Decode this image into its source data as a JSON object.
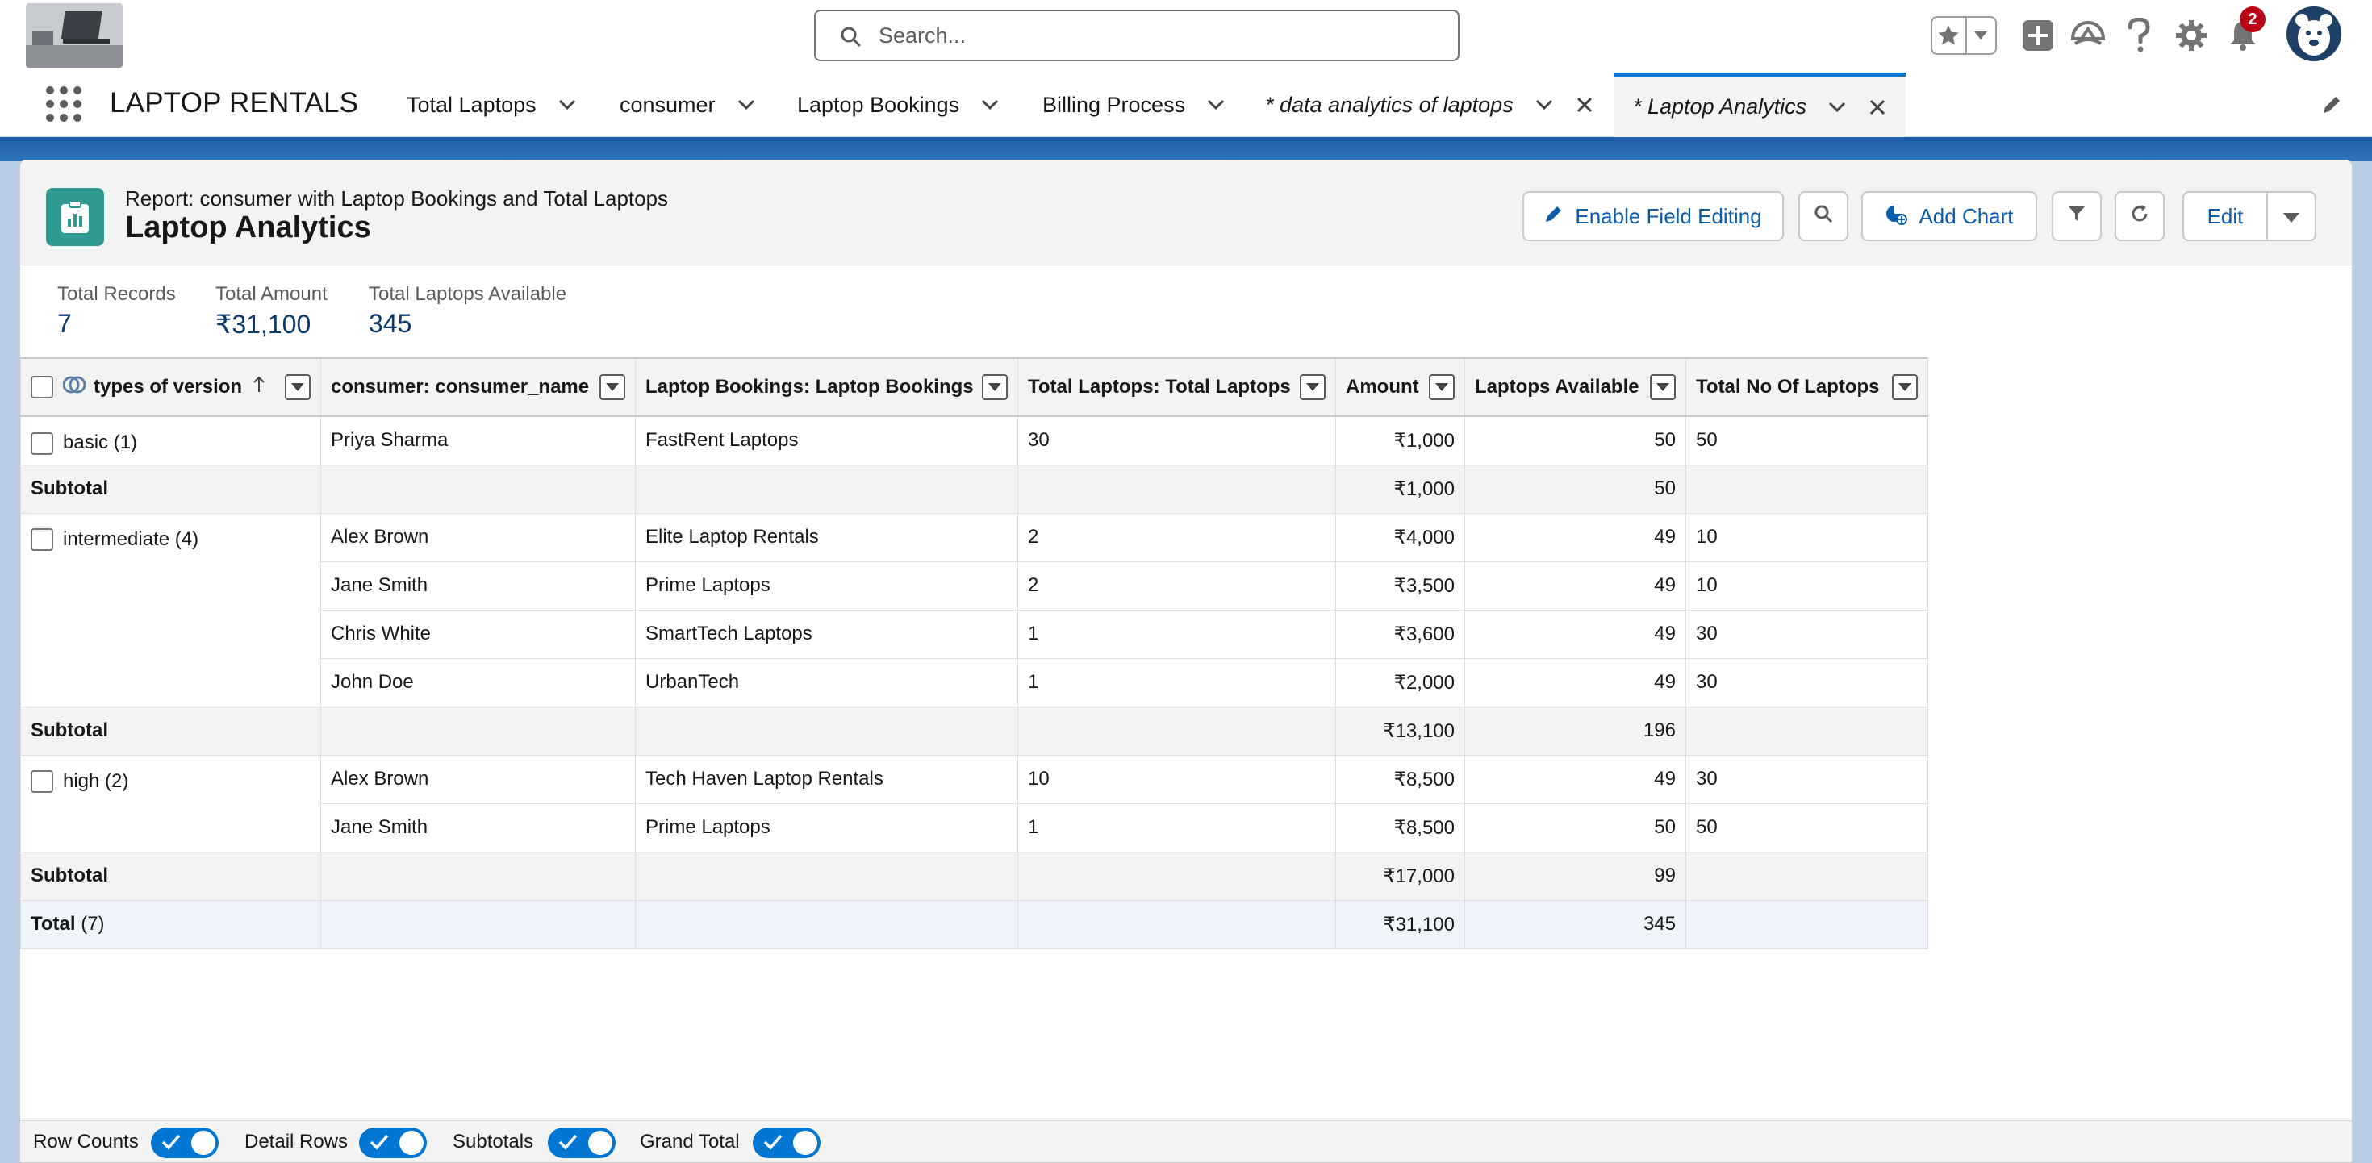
{
  "header": {
    "search_placeholder": "Search...",
    "notifications_count": "2"
  },
  "nav": {
    "app_name": "LAPTOP RENTALS",
    "tabs": [
      {
        "label": "Total Laptops"
      },
      {
        "label": "consumer"
      },
      {
        "label": "Laptop Bookings"
      },
      {
        "label": "Billing Process"
      },
      {
        "label": "* data analytics of laptops"
      },
      {
        "label": "* Laptop Analytics"
      }
    ]
  },
  "report": {
    "subtitle": "Report: consumer with Laptop Bookings and Total Laptops",
    "title": "Laptop Analytics",
    "buttons": {
      "enable_field_editing": "Enable Field Editing",
      "add_chart": "Add Chart",
      "edit": "Edit"
    },
    "summary": [
      {
        "label": "Total Records",
        "value": "7"
      },
      {
        "label": "Total Amount",
        "value": "₹31,100"
      },
      {
        "label": "Total Laptops Available",
        "value": "345"
      }
    ],
    "columns": [
      "types of version",
      "consumer: consumer_name",
      "Laptop Bookings: Laptop Bookings",
      "Total Laptops: Total Laptops",
      "Amount",
      "Laptops Available",
      "Total No Of Laptops"
    ],
    "groups": [
      {
        "name": "basic (1)",
        "rows": [
          {
            "consumer": "Priya Sharma",
            "booking": "FastRent Laptops",
            "total": "30",
            "amount": "₹1,000",
            "available": "50",
            "total_no": "50"
          }
        ],
        "subtotal": {
          "amount": "₹1,000",
          "available": "50"
        }
      },
      {
        "name": "intermediate (4)",
        "rows": [
          {
            "consumer": "Alex Brown",
            "booking": "Elite Laptop Rentals",
            "total": "2",
            "amount": "₹4,000",
            "available": "49",
            "total_no": "10"
          },
          {
            "consumer": "Jane Smith",
            "booking": "Prime Laptops",
            "total": "2",
            "amount": "₹3,500",
            "available": "49",
            "total_no": "10"
          },
          {
            "consumer": "Chris White",
            "booking": "SmartTech Laptops",
            "total": "1",
            "amount": "₹3,600",
            "available": "49",
            "total_no": "30"
          },
          {
            "consumer": "John Doe",
            "booking": "UrbanTech",
            "total": "1",
            "amount": "₹2,000",
            "available": "49",
            "total_no": "30"
          }
        ],
        "subtotal": {
          "amount": "₹13,100",
          "available": "196"
        }
      },
      {
        "name": "high (2)",
        "rows": [
          {
            "consumer": "Alex Brown",
            "booking": "Tech Haven Laptop Rentals",
            "total": "10",
            "amount": "₹8,500",
            "available": "49",
            "total_no": "30"
          },
          {
            "consumer": "Jane Smith",
            "booking": "Prime Laptops",
            "total": "1",
            "amount": "₹8,500",
            "available": "50",
            "total_no": "50"
          }
        ],
        "subtotal": {
          "amount": "₹17,000",
          "available": "99"
        }
      }
    ],
    "subtotal_label": "Subtotal",
    "total": {
      "label": "Total",
      "count": "(7)",
      "amount": "₹31,100",
      "available": "345"
    }
  },
  "footer": {
    "toggles": [
      {
        "label": "Row Counts",
        "on": true
      },
      {
        "label": "Detail Rows",
        "on": true
      },
      {
        "label": "Subtotals",
        "on": true
      },
      {
        "label": "Grand Total",
        "on": true
      }
    ]
  },
  "colors": {
    "brand_blue": "#0176d3",
    "link_blue": "#0b5cab",
    "report_icon": "#2e9a92",
    "badge_red": "#ba0517"
  }
}
